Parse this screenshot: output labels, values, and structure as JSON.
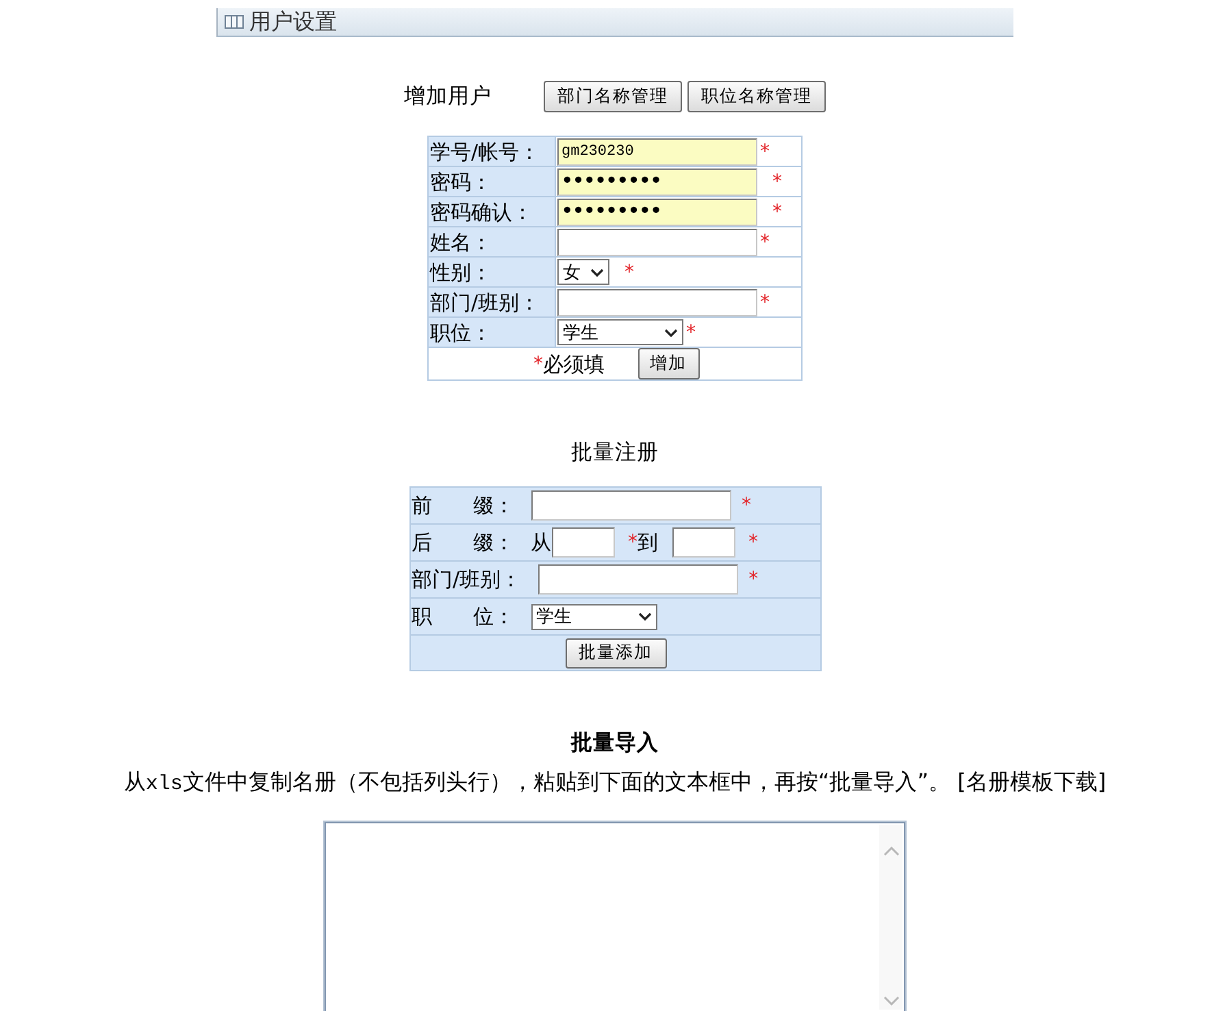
{
  "header": {
    "title": "用户设置"
  },
  "add_user": {
    "title": "增加用户",
    "buttons": [
      "部门名称管理",
      "职位名称管理"
    ],
    "fields": [
      {
        "label": "学号/帐号：",
        "kind": "text",
        "value": "gm230230",
        "autofilled": true,
        "required_mark": "*"
      },
      {
        "label": "密码：",
        "kind": "password",
        "value": "•••••••••",
        "autofilled": true,
        "required_mark": "*"
      },
      {
        "label": "密码确认：",
        "kind": "password",
        "value": "•••••••••",
        "autofilled": true,
        "required_mark": "*"
      },
      {
        "label": "姓名：",
        "kind": "text",
        "autofilled": false,
        "required_mark": "*"
      },
      {
        "label": "性别：",
        "kind": "select",
        "value": "女",
        "wide": false,
        "required_mark": "*"
      },
      {
        "label": "部门/班别：",
        "kind": "text",
        "autofilled": false,
        "required_mark": "*"
      },
      {
        "label": "职位：",
        "kind": "select",
        "value": "学生",
        "wide": true,
        "required_mark": "*"
      }
    ],
    "required_note": {
      "mark": "*",
      "text": "必须填"
    },
    "submit_button": "增加"
  },
  "batch_register": {
    "title": "批量注册",
    "rows": [
      {
        "label": "前　　缀：",
        "kind": "text",
        "required_mark": "*"
      },
      {
        "label": "后　　缀：",
        "kind": "range",
        "from_label": "从",
        "from_mark": "*",
        "to_label": "到",
        "required_mark": "*"
      },
      {
        "label": "部门/班别：",
        "kind": "text",
        "required_mark": "*"
      },
      {
        "label": "职　　位：",
        "kind": "select",
        "value": "学生"
      }
    ],
    "submit_button": "批量添加"
  },
  "batch_import": {
    "title": "批量导入",
    "instructions": [
      {
        "kind": "plain",
        "text": "从"
      },
      {
        "kind": "code",
        "text": "xls"
      },
      {
        "kind": "plain",
        "text": "文件中复制名册（不包括列头行），粘贴到下面的文本框中，再按“批量导入”。"
      }
    ],
    "template_link": "[名册模板下载]"
  }
}
